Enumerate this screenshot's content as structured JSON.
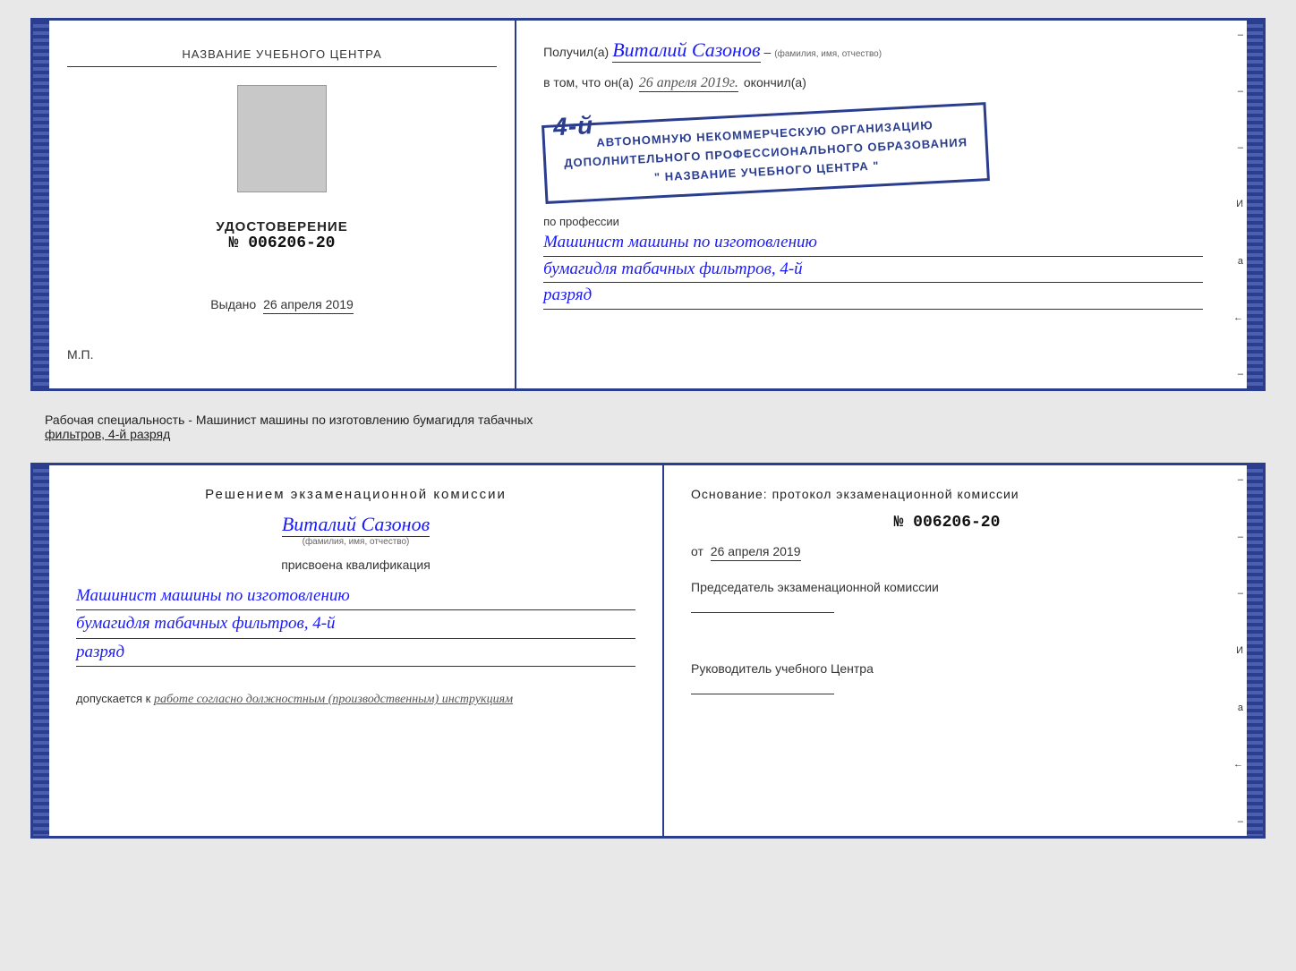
{
  "top_cert": {
    "left": {
      "school_label": "НАЗВАНИЕ УЧЕБНОГО ЦЕНТРА",
      "udostoverenie": "УДОСТОВЕРЕНИЕ",
      "number": "№ 006206-20",
      "vdano_prefix": "Выдано",
      "vdano_date": "26 апреля 2019",
      "mp": "М.П."
    },
    "right": {
      "poluchil_prefix": "Получил(а)",
      "name": "Виталий Сазонов",
      "fio_hint": "(фамилия, имя, отчество)",
      "dash": "–",
      "vtom_prefix": "в том, что он(а)",
      "vtom_date": "26 апреля 2019г.",
      "okonchil": "окончил(а)",
      "stamp_number": "4-й",
      "stamp_line1": "АВТОНОМНУЮ НЕКОММЕРЧЕСКУЮ ОРГАНИЗАЦИЮ",
      "stamp_line2": "ДОПОЛНИТЕЛЬНОГО ПРОФЕССИОНАЛЬНОГО ОБРАЗОВАНИЯ",
      "stamp_line3": "\" НАЗВАНИЕ УЧЕБНОГО ЦЕНТРА \"",
      "profession_label": "по профессии",
      "profession_line1": "Машинист машины по изготовлению",
      "profession_line2": "бумагидля табачных фильтров, 4-й",
      "profession_line3": "разряд"
    }
  },
  "middle": {
    "text": "Рабочая специальность - Машинист машины по изготовлению бумагидля табачных",
    "text2": "фильтров, 4-й разряд"
  },
  "bottom_cert": {
    "left": {
      "komissia_title": "Решением  экзаменационной  комиссии",
      "name": "Виталий Сазонов",
      "fio_hint": "(фамилия, имя, отчество)",
      "prisvoena": "присвоена квалификация",
      "qual_line1": "Машинист машины по изготовлению",
      "qual_line2": "бумагидля табачных фильтров, 4-й",
      "qual_line3": "разряд",
      "dopuskaetsya_prefix": "допускается к",
      "dopuskaetsya_text": "работе согласно должностным (производственным) инструкциям"
    },
    "right": {
      "osnovaniye": "Основание: протокол экзаменационной  комиссии",
      "number": "№ 006206-20",
      "ot_prefix": "от",
      "ot_date": "26 апреля 2019",
      "predsedatel_title": "Председатель экзаменационной комиссии",
      "rukovoditel_title": "Руководитель учебного Центра"
    }
  },
  "side_marks": {
    "items": [
      "–",
      "–",
      "–",
      "И",
      "ֻa",
      "←",
      "–"
    ]
  }
}
